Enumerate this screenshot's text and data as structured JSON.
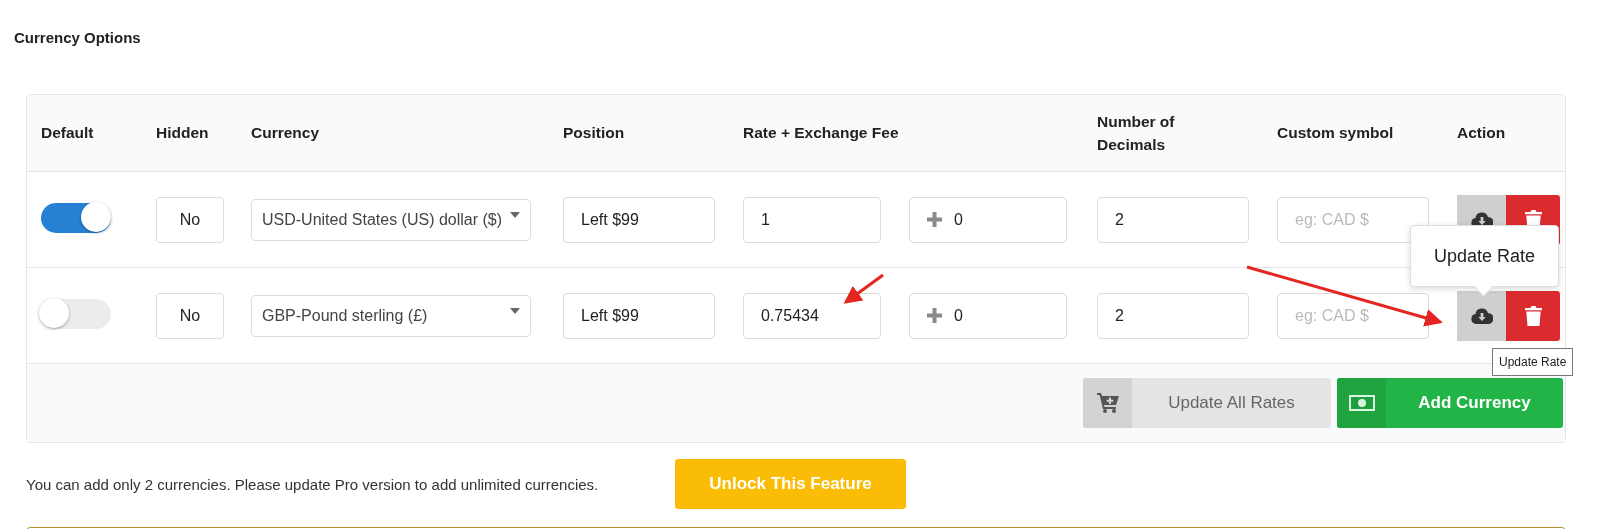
{
  "title": "Currency Options",
  "columns": [
    "Default",
    "Hidden",
    "Currency",
    "Position",
    "Rate + Exchange Fee",
    "Number of Decimals",
    "Custom symbol",
    "Action"
  ],
  "rows": [
    {
      "default_on": true,
      "hidden": "No",
      "currency": "USD-United States (US) dollar ($)",
      "position": "Left $99",
      "rate": "1",
      "fee": "0",
      "decimals": "2",
      "custom_symbol_placeholder": "eg: CAD $"
    },
    {
      "default_on": false,
      "hidden": "No",
      "currency": "GBP-Pound sterling (£)",
      "position": "Left $99",
      "rate": "0.75434",
      "fee": "0",
      "decimals": "2",
      "custom_symbol_placeholder": "eg: CAD $"
    }
  ],
  "popover": "Update Rate",
  "tooltip": "Update Rate",
  "footer_buttons": [
    {
      "kind": "update",
      "label": "Update All Rates"
    },
    {
      "kind": "add",
      "label": "Add Currency"
    }
  ],
  "notice": "You can add only 2 currencies. Please update Pro version to add unlimited currencies.",
  "unlock_button": "Unlock This Feature"
}
